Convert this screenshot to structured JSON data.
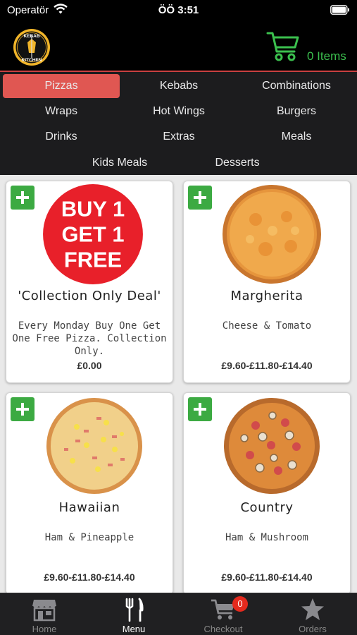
{
  "status_bar": {
    "carrier": "Operatör",
    "time": "ÖÖ 3:51"
  },
  "header": {
    "logo_text_top": "KEBAB",
    "logo_text_bottom": "KITCHEN",
    "cart_items": "0 Items",
    "accent_color": "#3bbf4e"
  },
  "categories": [
    {
      "label": "Pizzas",
      "active": true
    },
    {
      "label": "Kebabs"
    },
    {
      "label": "Combinations"
    },
    {
      "label": "Wraps"
    },
    {
      "label": "Hot Wings"
    },
    {
      "label": "Burgers"
    },
    {
      "label": "Drinks"
    },
    {
      "label": "Extras"
    },
    {
      "label": "Meals"
    },
    {
      "label": "Kids Meals"
    },
    {
      "label": "Desserts"
    }
  ],
  "products": [
    {
      "title": "'Collection Only Deal'",
      "description": "Every Monday Buy One Get One Free Pizza. Collection Only.",
      "price": "£0.00",
      "image": "buy-one-get-one-badge",
      "badge_lines": [
        "BUY 1",
        "GET 1",
        "FREE"
      ]
    },
    {
      "title": "Margherita",
      "description": "Cheese & Tomato",
      "price": "£9.60-£11.80-£14.40",
      "image": "margherita-pizza"
    },
    {
      "title": "Hawaiian",
      "description": "Ham & Pineapple",
      "price": "£9.60-£11.80-£14.40",
      "image": "hawaiian-pizza"
    },
    {
      "title": "Country",
      "description": "Ham & Mushroom",
      "price": "£9.60-£11.80-£14.40",
      "image": "country-pizza"
    }
  ],
  "tabbar": {
    "home": "Home",
    "menu": "Menu",
    "checkout": "Checkout",
    "orders": "Orders",
    "checkout_badge": "0",
    "active": "menu"
  },
  "colors": {
    "active_category": "#e05752",
    "add_button": "#3caa42",
    "badge": "#e42a1e"
  }
}
